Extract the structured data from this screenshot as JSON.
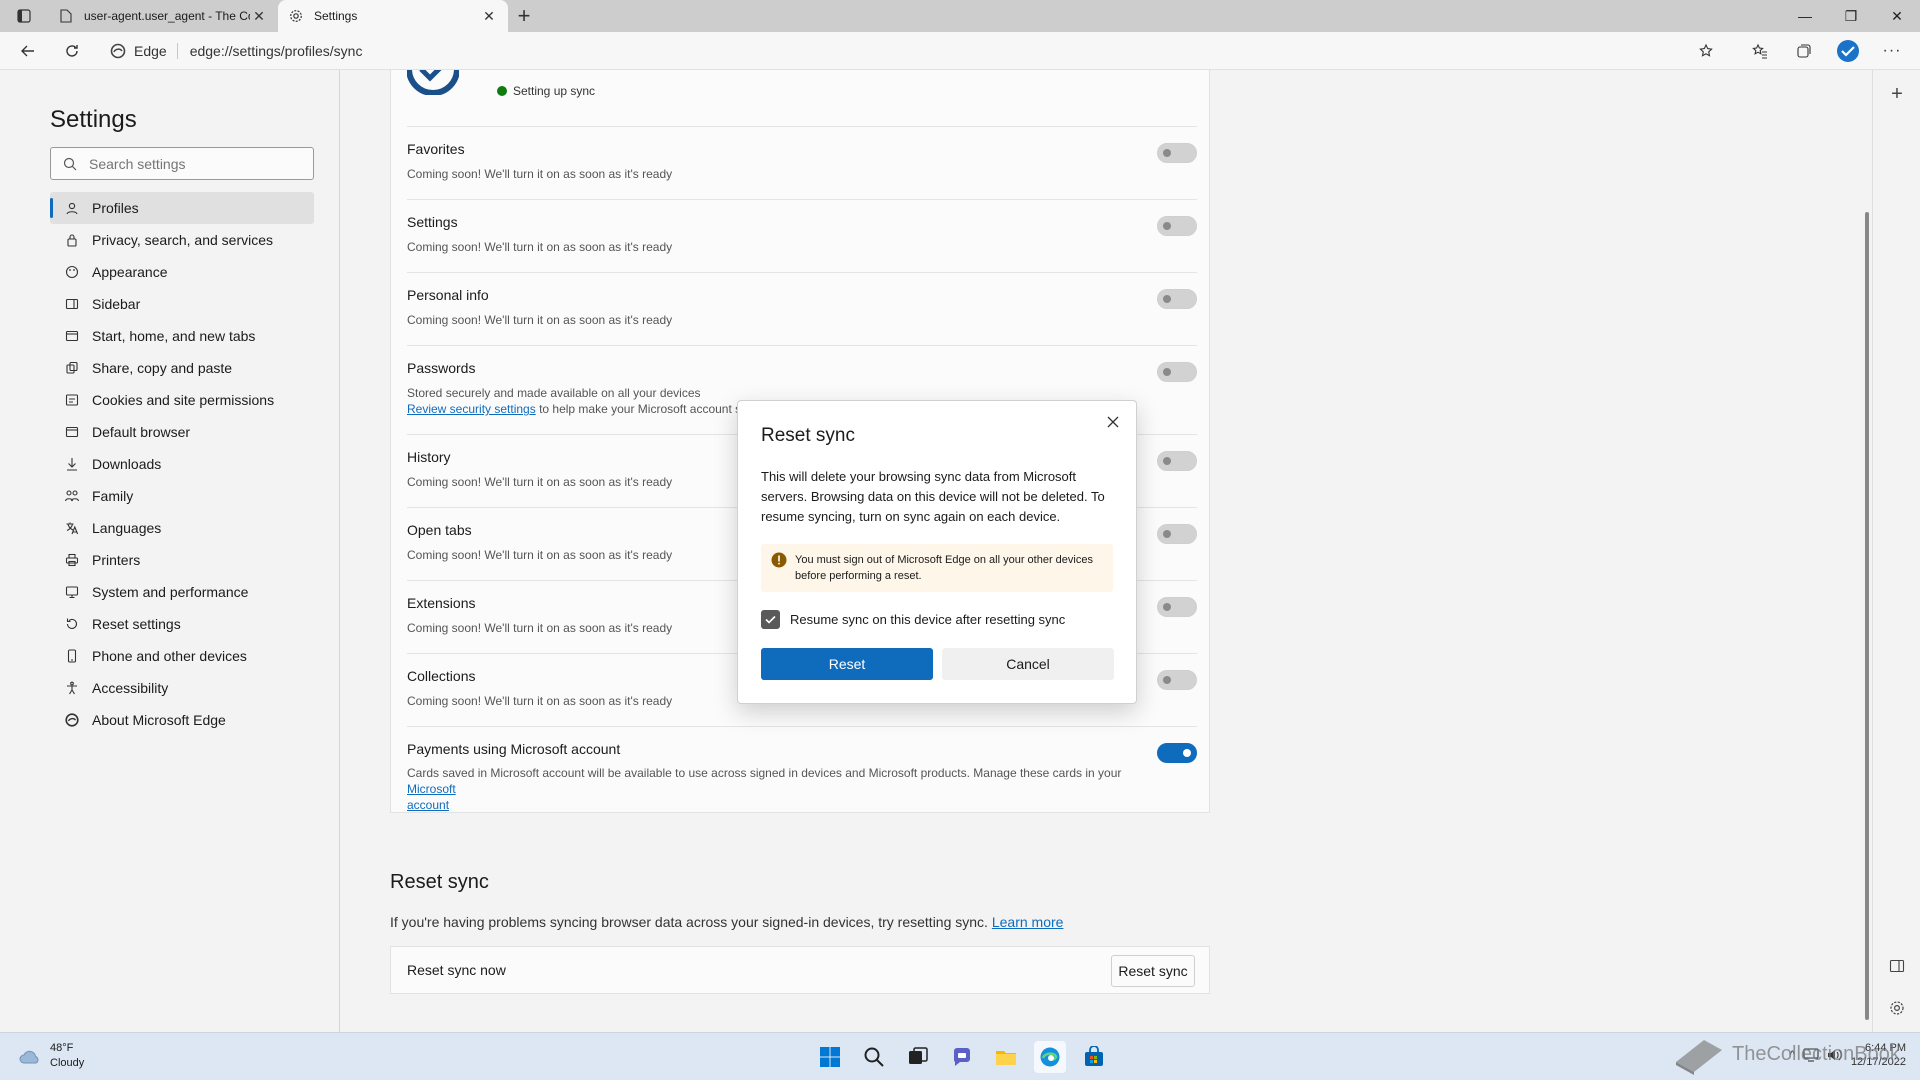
{
  "tabs": [
    {
      "title": "user-agent.user_agent - The Coll",
      "icon": "document-icon"
    },
    {
      "title": "Settings",
      "icon": "gear-icon"
    }
  ],
  "address": {
    "chip": "Edge",
    "url": "edge://settings/profiles/sync"
  },
  "sidebar": {
    "title": "Settings",
    "search_placeholder": "Search settings",
    "items": [
      {
        "label": "Profiles",
        "icon": "profile-icon"
      },
      {
        "label": "Privacy, search, and services",
        "icon": "lock-icon"
      },
      {
        "label": "Appearance",
        "icon": "palette-icon"
      },
      {
        "label": "Sidebar",
        "icon": "sidebar-icon"
      },
      {
        "label": "Start, home, and new tabs",
        "icon": "home-icon"
      },
      {
        "label": "Share, copy and paste",
        "icon": "share-icon"
      },
      {
        "label": "Cookies and site permissions",
        "icon": "cookie-icon"
      },
      {
        "label": "Default browser",
        "icon": "browser-icon"
      },
      {
        "label": "Downloads",
        "icon": "download-icon"
      },
      {
        "label": "Family",
        "icon": "family-icon"
      },
      {
        "label": "Languages",
        "icon": "language-icon"
      },
      {
        "label": "Printers",
        "icon": "printer-icon"
      },
      {
        "label": "System and performance",
        "icon": "system-icon"
      },
      {
        "label": "Reset settings",
        "icon": "reset-icon"
      },
      {
        "label": "Phone and other devices",
        "icon": "phone-icon"
      },
      {
        "label": "Accessibility",
        "icon": "accessibility-icon"
      },
      {
        "label": "About Microsoft Edge",
        "icon": "edge-icon"
      }
    ]
  },
  "sync": {
    "status": "Setting up sync",
    "rows": [
      {
        "title": "Favorites",
        "desc": "Coming soon! We'll turn it on as soon as it's ready"
      },
      {
        "title": "Settings",
        "desc": "Coming soon! We'll turn it on as soon as it's ready"
      },
      {
        "title": "Personal info",
        "desc": "Coming soon! We'll turn it on as soon as it's ready"
      },
      {
        "title": "Passwords",
        "desc": "Stored securely and made available on all your devices",
        "link": "Review security settings",
        "link_after": "to help make your Microsoft account s"
      },
      {
        "title": "History",
        "desc": "Coming soon! We'll turn it on as soon as it's ready"
      },
      {
        "title": "Open tabs",
        "desc": "Coming soon! We'll turn it on as soon as it's ready"
      },
      {
        "title": "Extensions",
        "desc": "Coming soon! We'll turn it on as soon as it's ready"
      },
      {
        "title": "Collections",
        "desc": "Coming soon! We'll turn it on as soon as it's ready"
      }
    ],
    "payments": {
      "title": "Payments using Microsoft account",
      "desc": "Cards saved in Microsoft account will be available to use across signed in devices and Microsoft products. Manage these cards in your",
      "link1": "Microsoft",
      "link2": "account"
    }
  },
  "reset_section": {
    "title": "Reset sync",
    "desc": "If you're having problems syncing browser data across your signed-in devices, try resetting sync.",
    "learn_more": "Learn more",
    "row_title": "Reset sync now",
    "button": "Reset sync"
  },
  "modal": {
    "title": "Reset sync",
    "body": "This will delete your browsing sync data from Microsoft servers. Browsing data on this device will not be deleted. To resume syncing, turn on sync again on each device.",
    "warning": "You must sign out of Microsoft Edge on all your other devices before performing a reset.",
    "checkbox_label": "Resume sync on this device after resetting sync",
    "reset_label": "Reset",
    "cancel_label": "Cancel"
  },
  "taskbar": {
    "temp": "48°F",
    "condition": "Cloudy",
    "time": "6:44 PM",
    "date": "12/17/2022"
  },
  "watermark": "TheCollectionBook"
}
